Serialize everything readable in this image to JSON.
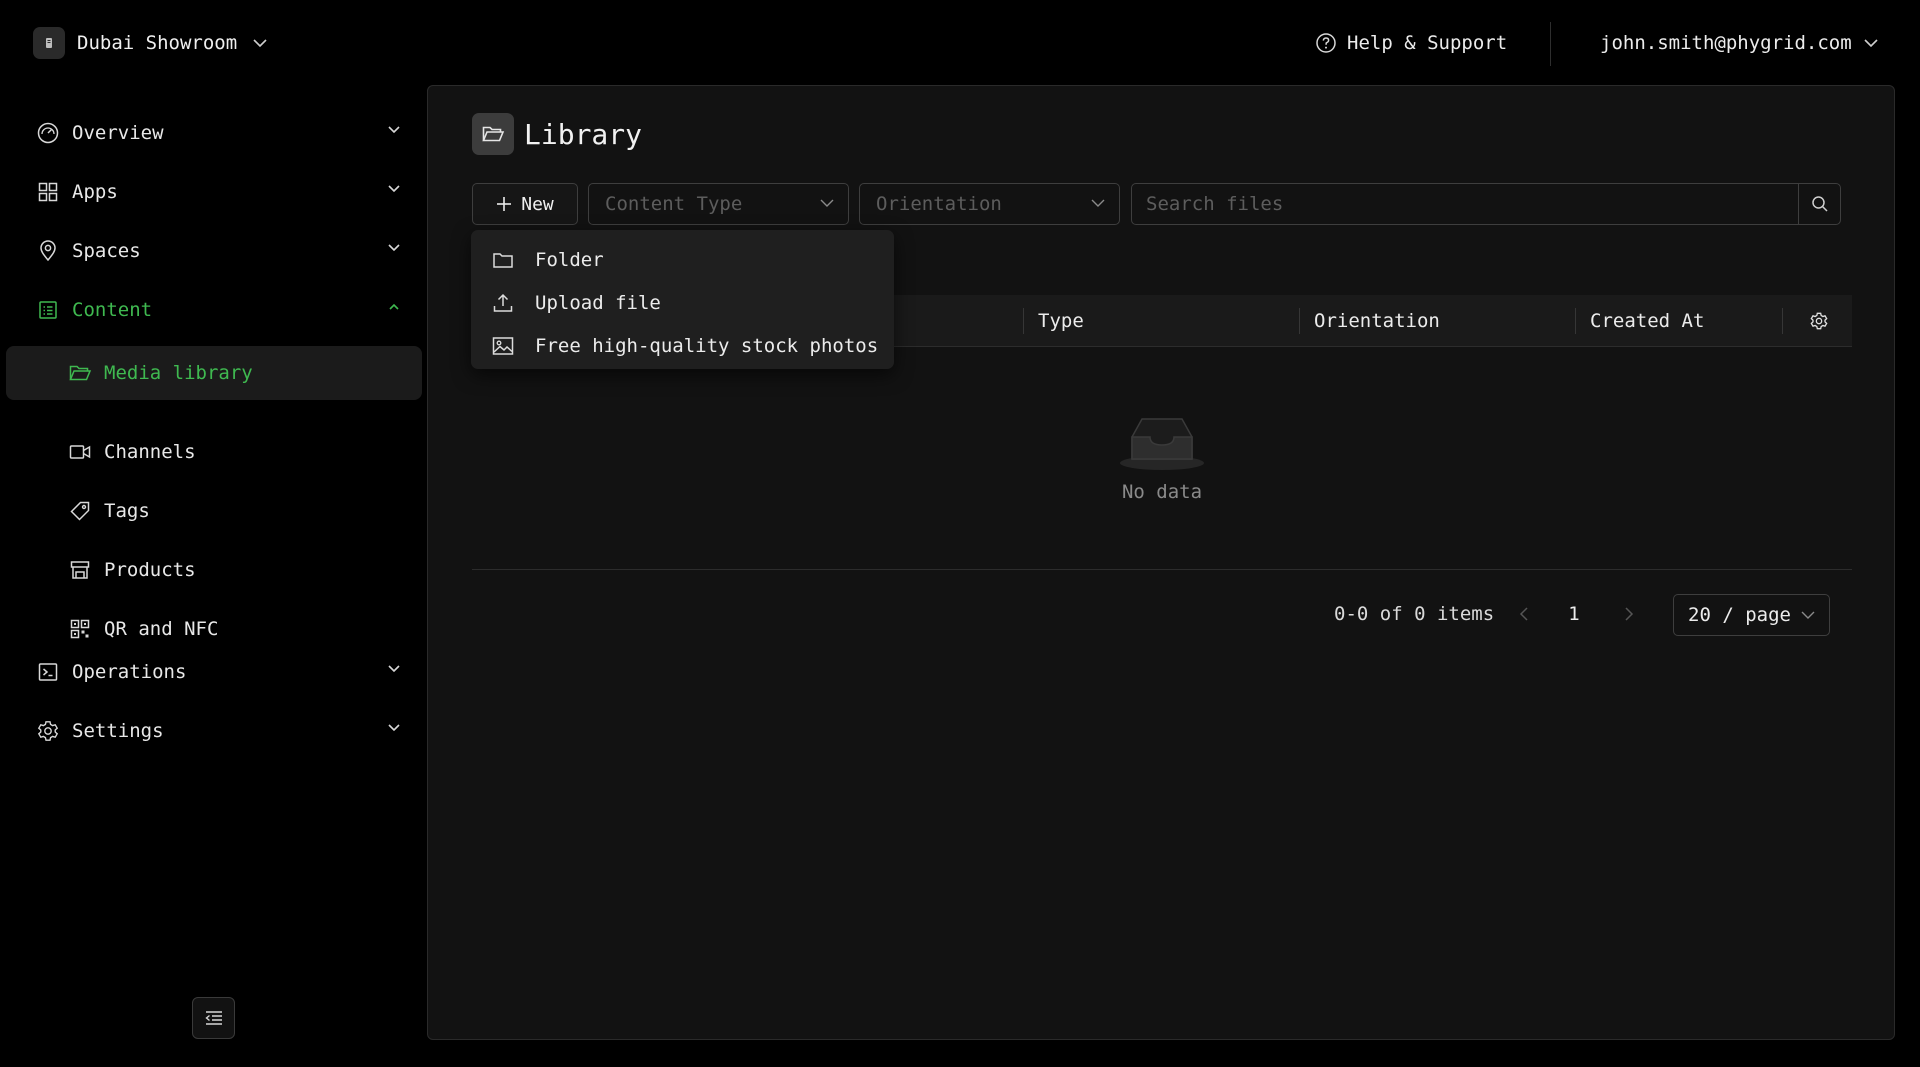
{
  "workspace": {
    "name": "Dubai Showroom"
  },
  "header": {
    "help_label": "Help & Support",
    "account_email": "john.smith@phygrid.com"
  },
  "sidebar": {
    "items": [
      {
        "label": "Overview",
        "icon": "dashboard-gauge-icon"
      },
      {
        "label": "Apps",
        "icon": "grid-icon"
      },
      {
        "label": "Spaces",
        "icon": "location-pin-icon"
      },
      {
        "label": "Content",
        "icon": "content-list-icon",
        "expanded": true
      },
      {
        "label": "Operations",
        "icon": "terminal-icon"
      },
      {
        "label": "Settings",
        "icon": "gear-icon"
      }
    ],
    "content_children": [
      {
        "label": "Media library",
        "icon": "folder-open-icon",
        "selected": true
      },
      {
        "label": "Channels",
        "icon": "video-camera-icon"
      },
      {
        "label": "Tags",
        "icon": "tag-icon"
      },
      {
        "label": "Products",
        "icon": "store-icon"
      },
      {
        "label": "QR and NFC",
        "icon": "qr-code-icon"
      }
    ]
  },
  "main": {
    "title": "Library",
    "toolbar": {
      "new_label": "New",
      "content_type_placeholder": "Content Type",
      "orientation_placeholder": "Orientation",
      "search_placeholder": "Search files"
    },
    "new_menu": [
      {
        "label": "Folder",
        "icon": "folder-icon"
      },
      {
        "label": "Upload file",
        "icon": "upload-icon"
      },
      {
        "label": "Free high-quality stock photos",
        "icon": "image-icon"
      }
    ],
    "table": {
      "columns": [
        "Type",
        "Orientation",
        "Created At"
      ],
      "empty_text": "No data"
    },
    "pagination": {
      "total_text": "0-0 of 0 items",
      "current_page": "1",
      "page_size": "20 / page"
    }
  },
  "colors": {
    "accent": "#3fb950",
    "background": "#000000",
    "panel": "#121212"
  }
}
